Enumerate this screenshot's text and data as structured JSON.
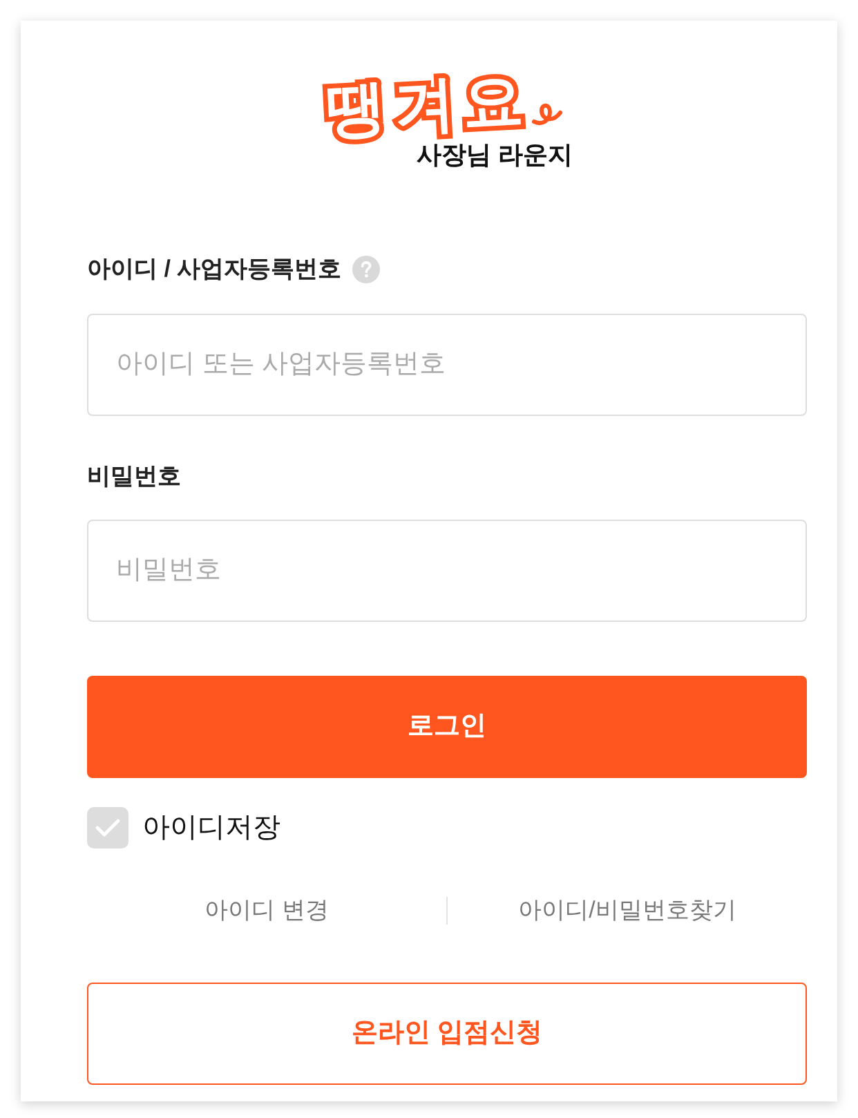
{
  "logo": {
    "wordmark": "땡겨요",
    "subtitle": "사장님 라운지"
  },
  "form": {
    "fields": [
      {
        "label": "아이디 / 사업자등록번호",
        "help": true,
        "placeholder": "아이디 또는 사업자등록번호"
      },
      {
        "label": "비밀번호",
        "help": false,
        "placeholder": "비밀번호"
      }
    ],
    "login_button": "로그인",
    "remember": {
      "label": "아이디저장",
      "checked": false
    },
    "links": [
      "아이디 변경",
      "아이디/비밀번호찾기"
    ],
    "signup_button": "온라인 입점신청"
  }
}
